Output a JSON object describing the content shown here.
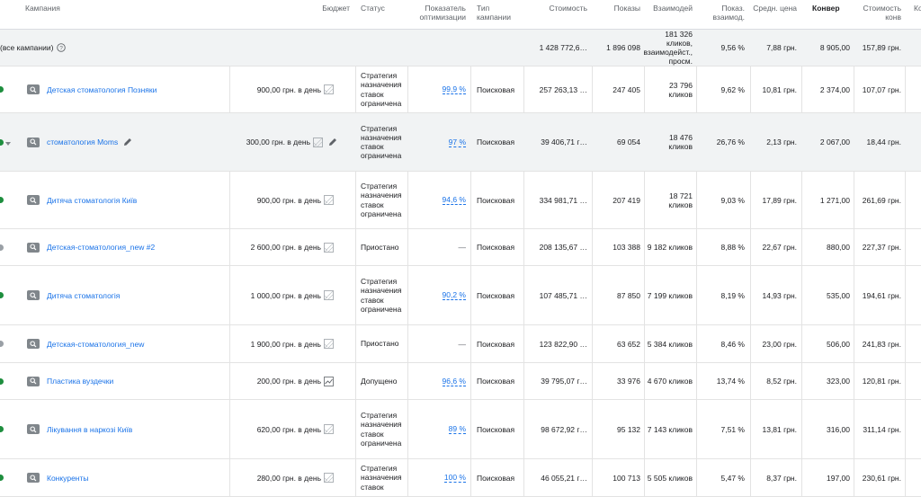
{
  "header": {
    "campaign": "Кампания",
    "budget": "Бюджет",
    "status": "Статус",
    "optimization": "Показатель оптимизации",
    "type": "Тип кампании",
    "cost": "Стоимость",
    "impressions": "Показы",
    "interactions": "Взаимодей",
    "interaction_rate": "Показ. взаимод.",
    "avg_cost": "Средн. цена",
    "conversions": "Конвер",
    "cost_per_conv": "Стоимость конв",
    "last": "Ко"
  },
  "total": {
    "label": "все кампании)",
    "cost": "1 428 772,6…",
    "impressions": "1 896 098",
    "interactions": "181 326 кликов, взаимодейст., просм.",
    "interaction_rate": "9,56 %",
    "avg_cost": "7,88 грн.",
    "conversions": "8 905,00",
    "cost_per_conv": "157,89 грн."
  },
  "rows": [
    {
      "name": "Детская стоматология Позняки",
      "budget": "900,00 грн. в день",
      "status": "Стратегия назначения ставок ограничена",
      "opt": "99,9 %",
      "type": "Поисковая",
      "cost": "257 263,13 …",
      "impr": "247 405",
      "inter": "23 796 кликов",
      "rate": "9,62 %",
      "avg": "10,81 грн.",
      "conv": "2 374,00",
      "cpc": "107,07 грн.",
      "dot": "green",
      "chart": "img"
    },
    {
      "name": "стоматология Moms",
      "budget": "300,00 грн. в день",
      "status": "Стратегия назначения ставок ограничена",
      "opt": "97 %",
      "type": "Поисковая",
      "cost": "39 406,71 г…",
      "impr": "69 054",
      "inter": "18 476 кликов",
      "rate": "26,76 %",
      "avg": "2,13 грн.",
      "conv": "2 067,00",
      "cpc": "18,44 грн.",
      "dot": "green",
      "chart": "img"
    },
    {
      "name": "Дитяча стоматологія Київ",
      "budget": "900,00 грн. в день",
      "status": "Стратегия назначения ставок ограничена",
      "opt": "94,6 %",
      "type": "Поисковая",
      "cost": "334 981,71 …",
      "impr": "207 419",
      "inter": "18 721 кликов",
      "rate": "9,03 %",
      "avg": "17,89 грн.",
      "conv": "1 271,00",
      "cpc": "261,69 грн.",
      "dot": "green",
      "chart": "img"
    },
    {
      "name": "Детская-стоматология_new #2",
      "budget": "2 600,00 грн. в день",
      "status": "Приостано",
      "opt": "—",
      "type": "Поисковая",
      "cost": "208 135,67 …",
      "impr": "103 388",
      "inter": "9 182 кликов",
      "rate": "8,88 %",
      "avg": "22,67 грн.",
      "conv": "880,00",
      "cpc": "227,37 грн.",
      "dot": "grey",
      "chart": "img"
    },
    {
      "name": "Дитяча стоматологія",
      "budget": "1 000,00 грн. в день",
      "status": "Стратегия назначения ставок ограничена",
      "opt": "90,2 %",
      "type": "Поисковая",
      "cost": "107 485,71 …",
      "impr": "87 850",
      "inter": "7 199 кликов",
      "rate": "8,19 %",
      "avg": "14,93 грн.",
      "conv": "535,00",
      "cpc": "194,61 грн.",
      "dot": "green",
      "chart": "img"
    },
    {
      "name": "Детская-стоматология_new",
      "budget": "1 900,00 грн. в день",
      "status": "Приостано",
      "opt": "—",
      "type": "Поисковая",
      "cost": "123 822,90 …",
      "impr": "63 652",
      "inter": "5 384 кликов",
      "rate": "8,46 %",
      "avg": "23,00 грн.",
      "conv": "506,00",
      "cpc": "241,83 грн.",
      "dot": "grey",
      "chart": "img"
    },
    {
      "name": "Пластика вуздечки",
      "budget": "200,00 грн. в день",
      "status": "Допущено",
      "opt": "96,6 %",
      "type": "Поисковая",
      "cost": "39 795,07 г…",
      "impr": "33 976",
      "inter": "4 670 кликов",
      "rate": "13,74 %",
      "avg": "8,52 грн.",
      "conv": "323,00",
      "cpc": "120,81 грн.",
      "dot": "green",
      "chart": "trend"
    },
    {
      "name": "Лікування в наркозі Київ",
      "budget": "620,00 грн. в день",
      "status": "Стратегия назначения ставок ограничена",
      "opt": "89 %",
      "type": "Поисковая",
      "cost": "98 672,92 г…",
      "impr": "95 132",
      "inter": "7 143 кликов",
      "rate": "7,51 %",
      "avg": "13,81 грн.",
      "conv": "316,00",
      "cpc": "311,14 грн.",
      "dot": "green",
      "chart": "img"
    },
    {
      "name": "Конкуренты",
      "budget": "280,00 грн. в день",
      "status": "Стратегия назначения ставок",
      "opt": "100 %",
      "type": "Поисковая",
      "cost": "46 055,21 г…",
      "impr": "100 713",
      "inter": "5 505 кликов",
      "rate": "5,47 %",
      "avg": "8,37 грн.",
      "conv": "197,00",
      "cpc": "230,61 грн.",
      "dot": "green",
      "chart": "img"
    }
  ]
}
